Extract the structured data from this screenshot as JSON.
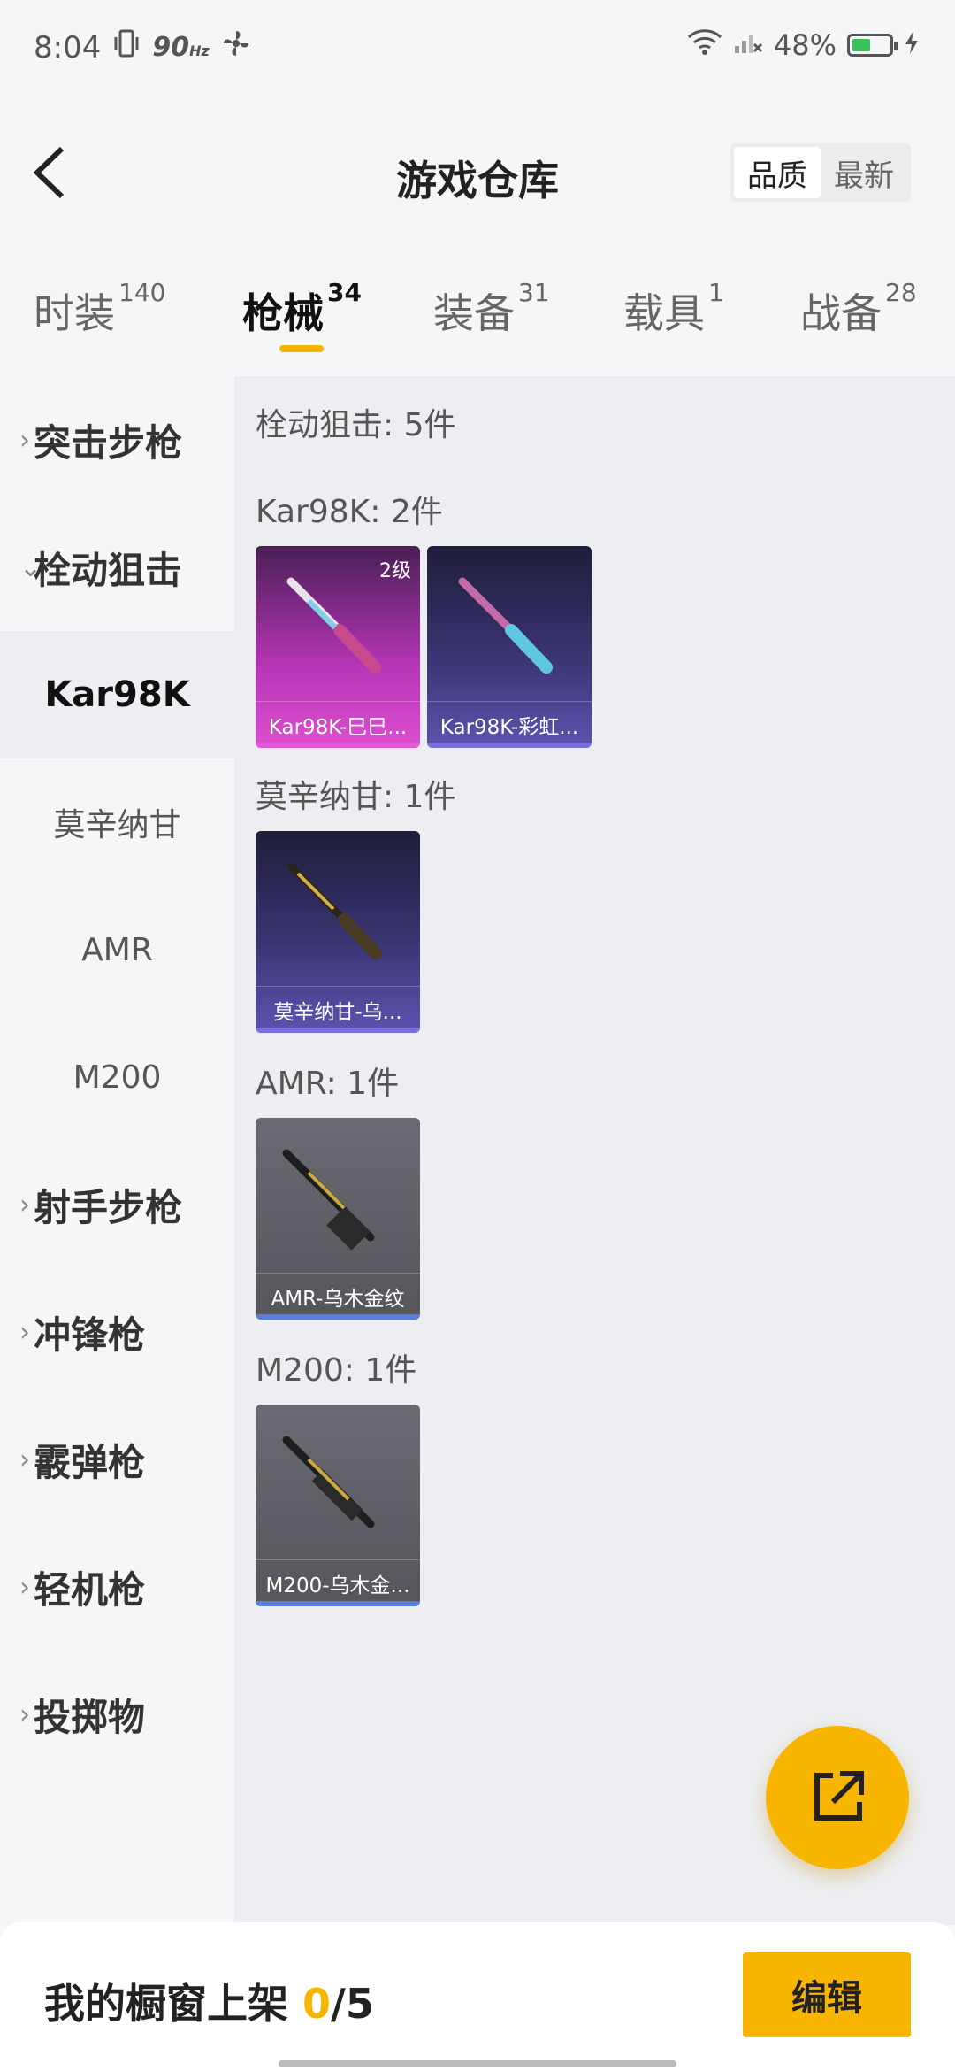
{
  "status": {
    "time": "8:04",
    "refresh": "90",
    "refresh_unit": "Hz",
    "battery": "48%"
  },
  "header": {
    "title": "游戏仓库",
    "sort_options": [
      "品质",
      "最新"
    ]
  },
  "tabs": [
    {
      "label": "时装",
      "count": "140"
    },
    {
      "label": "枪械",
      "count": "34"
    },
    {
      "label": "装备",
      "count": "31"
    },
    {
      "label": "载具",
      "count": "1"
    },
    {
      "label": "战备",
      "count": "28"
    }
  ],
  "sidebar": {
    "categories": [
      "突击步枪",
      "栓动狙击",
      "射手步枪",
      "冲锋枪",
      "霰弹枪",
      "轻机枪",
      "投掷物"
    ],
    "subitems": [
      "Kar98K",
      "莫辛纳甘",
      "AMR",
      "M200"
    ]
  },
  "content": {
    "summary": "栓动狙击: 5件",
    "groups": [
      {
        "label": "Kar98K: 2件",
        "items": [
          {
            "name": "Kar98K-巳巳...",
            "level": "2级"
          },
          {
            "name": "Kar98K-彩虹..."
          }
        ]
      },
      {
        "label": "莫辛纳甘: 1件",
        "items": [
          {
            "name": "莫辛纳甘-乌..."
          }
        ]
      },
      {
        "label": "AMR: 1件",
        "items": [
          {
            "name": "AMR-乌木金纹"
          }
        ]
      },
      {
        "label": "M200: 1件",
        "items": [
          {
            "name": "M200-乌木金..."
          }
        ]
      }
    ]
  },
  "bottom": {
    "shelf_label": "我的橱窗上架",
    "shelf_count": "0",
    "shelf_total": "/5",
    "edit_label": "编辑"
  },
  "colors": {
    "accent": "#f7b500"
  }
}
